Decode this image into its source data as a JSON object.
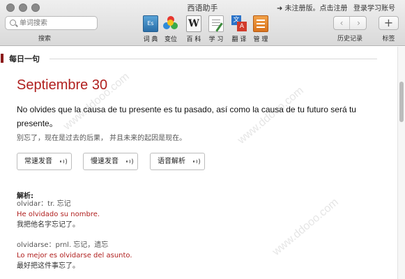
{
  "window": {
    "title": "西语助手"
  },
  "account": {
    "register": "➜ 未注册版。点击注册",
    "login": "登录学习账号"
  },
  "search": {
    "placeholder": "单词搜索",
    "caption": "搜索"
  },
  "toolbar": {
    "tools": [
      {
        "label": "词 典",
        "icon": "dictionary-icon"
      },
      {
        "label": "变位",
        "icon": "conjugation-icon"
      },
      {
        "label": "百 科",
        "icon": "wikipedia-icon"
      },
      {
        "label": "学 习",
        "icon": "study-icon"
      },
      {
        "label": "翻 译",
        "icon": "translate-icon"
      },
      {
        "label": "管 理",
        "icon": "manage-icon"
      }
    ],
    "dict_icon_text": "Es",
    "wiki_icon_text": "W",
    "trans_icon_a": "文",
    "trans_icon_b": "A",
    "history_caption": "历史记录",
    "back_glyph": "‹",
    "forward_glyph": "›",
    "add_glyph": "+",
    "tags_caption": "标签"
  },
  "daily": {
    "heading": "每日一句",
    "date": "Septiembre 30",
    "sentence": "No olvides que la causa de tu presente es tu pasado, así como la causa de tu futuro será tu presente。",
    "translation": "别忘了，现在是过去的后果，  并且未来的起因是现在。",
    "buttons": [
      "常速发音",
      "慢速发音",
      "语音解析"
    ]
  },
  "analysis": {
    "heading": "解析:",
    "entries": [
      {
        "word": "olvidar：tr. 忘记",
        "example": "He olvidado su nombre.",
        "translation": "我把他名字忘记了。"
      },
      {
        "word": "olvidarse：prnl. 忘记，遗忘",
        "example": "Lo mejor es olvidarse del asunto.",
        "translation": "最好把这件事忘了。"
      }
    ]
  },
  "watermark": "www.ddooo.com",
  "colors": {
    "accent": "#b0201f",
    "section_bar": "#8b1a1a"
  }
}
